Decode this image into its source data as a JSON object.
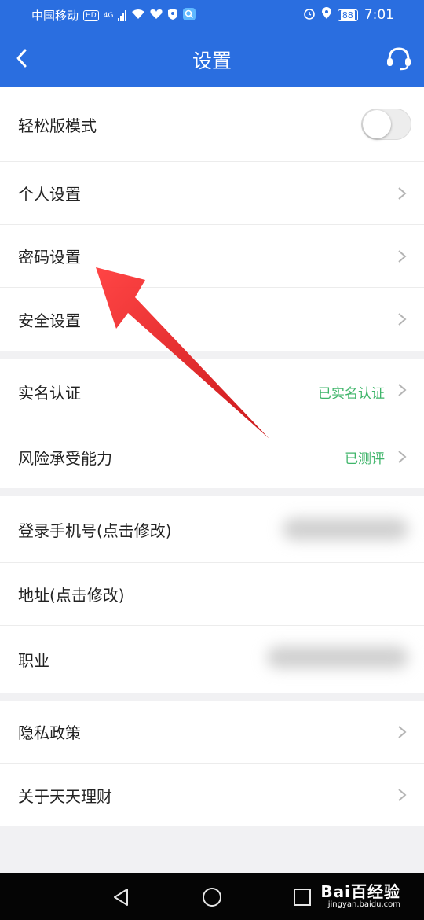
{
  "status_bar": {
    "carrier": "中国移动",
    "hd": "HD",
    "network": "4G",
    "battery": "88",
    "time": "7:01"
  },
  "header": {
    "title": "设置"
  },
  "groups": [
    [
      {
        "label": "轻松版模式",
        "type": "toggle",
        "toggle_on": false
      },
      {
        "label": "个人设置",
        "type": "nav"
      },
      {
        "label": "密码设置",
        "type": "nav"
      },
      {
        "label": "安全设置",
        "type": "nav"
      }
    ],
    [
      {
        "label": "实名认证",
        "type": "nav",
        "value": "已实名认证"
      },
      {
        "label": "风险承受能力",
        "type": "nav",
        "value": "已测评"
      }
    ],
    [
      {
        "label": "登录手机号(点击修改)",
        "type": "blurred"
      },
      {
        "label": "地址(点击修改)",
        "type": "blurred"
      },
      {
        "label": "职业",
        "type": "blurred"
      }
    ],
    [
      {
        "label": "隐私政策",
        "type": "nav"
      },
      {
        "label": "关于天天理财",
        "type": "nav"
      }
    ]
  ],
  "colors": {
    "primary": "#2a6ee0",
    "value_green": "#3fb56a",
    "annotation_arrow": "#e8161a"
  },
  "watermark": {
    "main": "Bai百经验",
    "sub": "jingyan.baidu.com"
  }
}
